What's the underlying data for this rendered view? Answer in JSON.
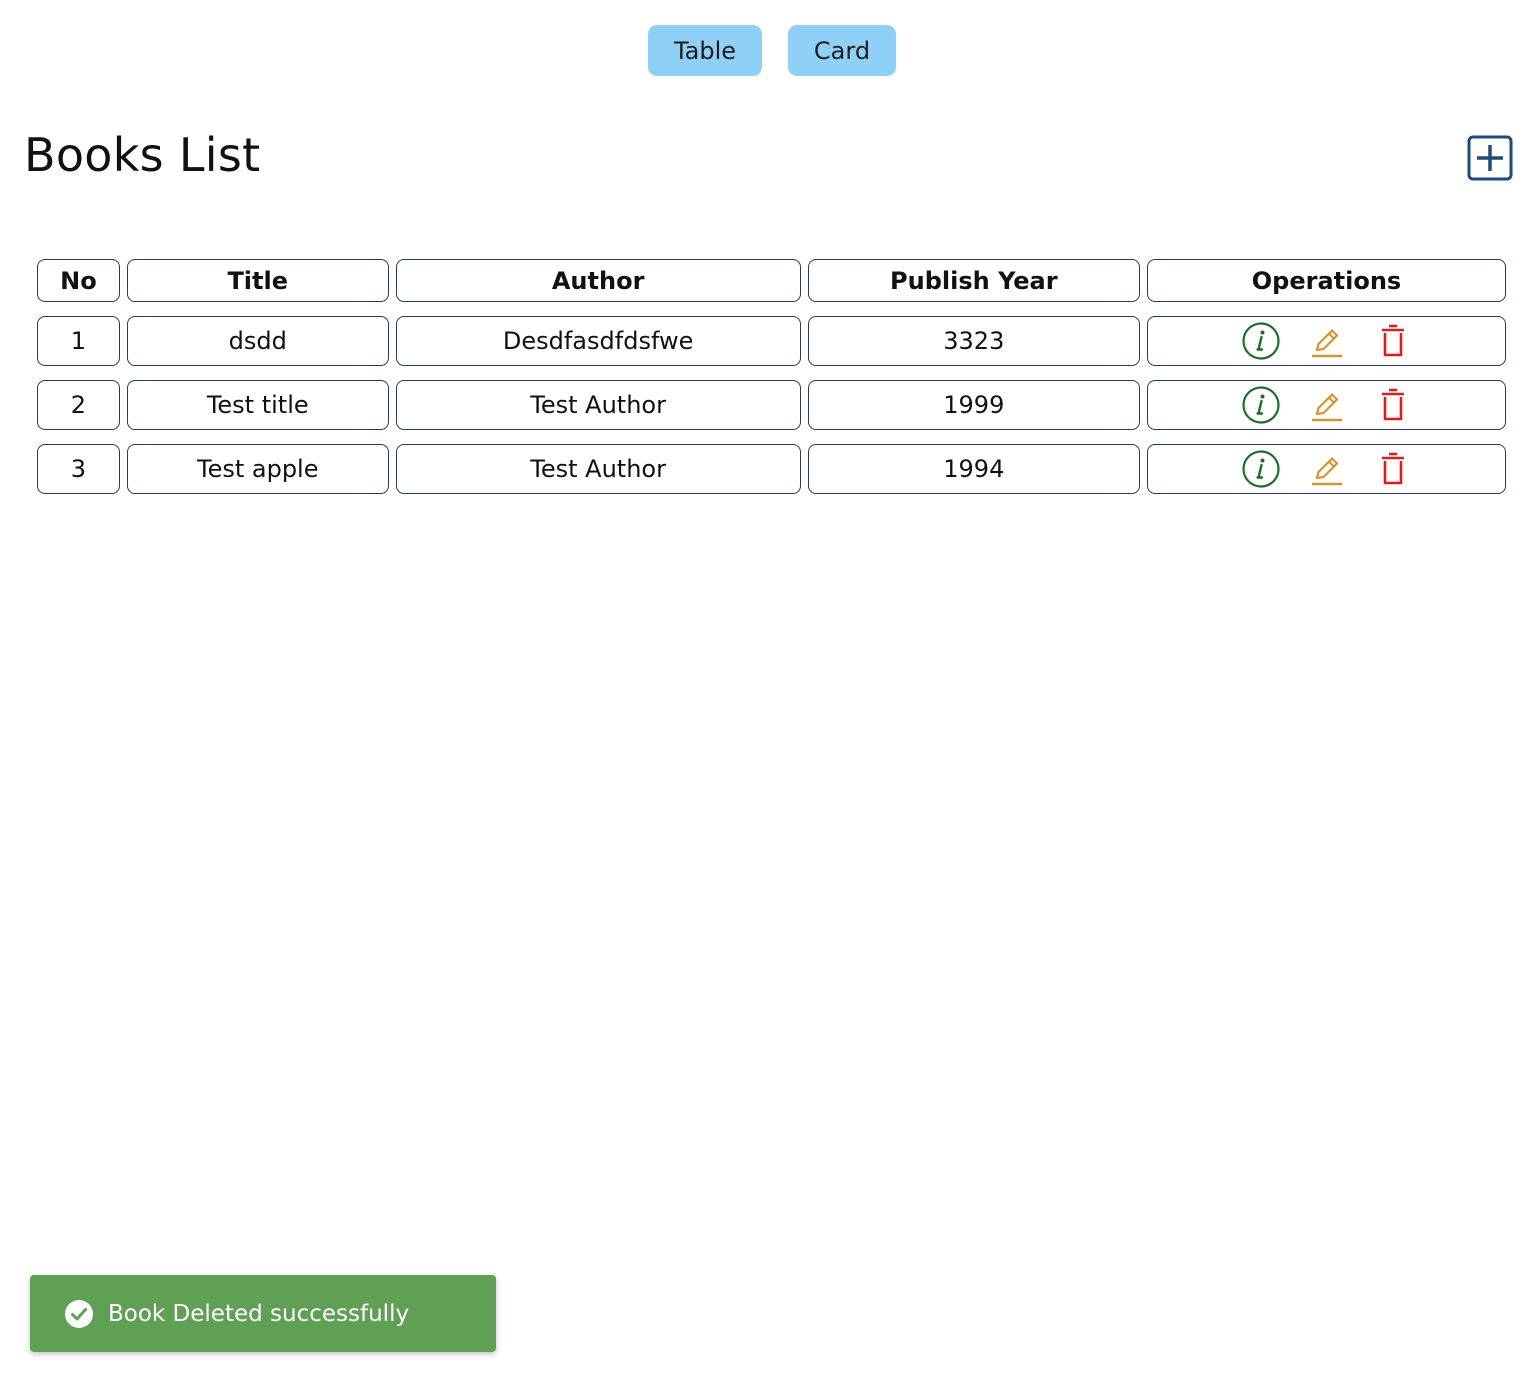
{
  "view_toggle": {
    "table_label": "Table",
    "card_label": "Card"
  },
  "header": {
    "title": "Books List"
  },
  "table": {
    "columns": [
      "No",
      "Title",
      "Author",
      "Publish Year",
      "Operations"
    ],
    "rows": [
      {
        "no": "1",
        "title": "dsdd",
        "author": "Desdfasdfdsfwe",
        "year": "3323"
      },
      {
        "no": "2",
        "title": "Test title",
        "author": "Test Author",
        "year": "1999"
      },
      {
        "no": "3",
        "title": "Test apple",
        "author": "Test Author",
        "year": "1994"
      }
    ],
    "operation_icons": [
      "info-icon",
      "edit-icon",
      "delete-icon"
    ]
  },
  "toast": {
    "message": "Book Deleted successfully",
    "icon": "check-circle-icon"
  },
  "colors": {
    "toggle_bg": "#8fd0f6",
    "add_button": "#1f4a7a",
    "info": "#1e6b2d",
    "edit": "#d4962a",
    "delete": "#d42020",
    "toast_bg": "#5fa055"
  }
}
